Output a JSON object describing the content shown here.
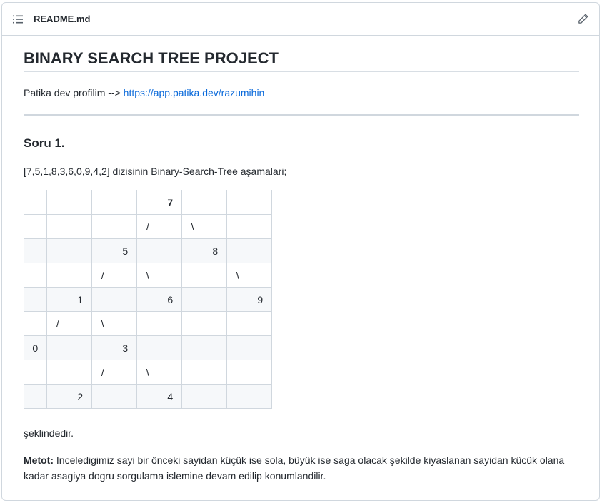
{
  "file": {
    "name": "README.md",
    "list_icon": "list-unordered-icon",
    "edit_icon": "pencil-icon"
  },
  "readme": {
    "title": "BINARY SEARCH TREE PROJECT",
    "profile_prefix": "Patika dev profilim -->",
    "profile_link": "https://app.patika.dev/razumihin",
    "question_heading": "Soru 1.",
    "intro": "[7,5,1,8,3,6,0,9,4,2] dizisinin Binary-Search-Tree aşamalari;",
    "tree_grid": [
      [
        "",
        "",
        "",
        "",
        "",
        "",
        "7",
        "",
        "",
        "",
        ""
      ],
      [
        "",
        "",
        "",
        "",
        "",
        "/",
        "",
        "\\",
        "",
        "",
        ""
      ],
      [
        "",
        "",
        "",
        "",
        "5",
        "",
        "",
        "",
        "8",
        "",
        ""
      ],
      [
        "",
        "",
        "",
        "/",
        "",
        "\\",
        "",
        "",
        "",
        "\\",
        ""
      ],
      [
        "",
        "",
        "1",
        "",
        "",
        "",
        "6",
        "",
        "",
        "",
        "9"
      ],
      [
        "",
        "/",
        "",
        "\\",
        "",
        "",
        "",
        "",
        "",
        "",
        ""
      ],
      [
        "0",
        "",
        "",
        "",
        "3",
        "",
        "",
        "",
        "",
        "",
        ""
      ],
      [
        "",
        "",
        "",
        "/",
        "",
        "\\",
        "",
        "",
        "",
        "",
        ""
      ],
      [
        "",
        "",
        "2",
        "",
        "",
        "",
        "4",
        "",
        "",
        "",
        ""
      ]
    ],
    "after_tree": "şeklindedir.",
    "method_label": "Metot:",
    "method_text": " Inceledigimiz sayi bir önceki sayidan küçük ise sola, büyük ise saga olacak şekilde kiyaslanan sayidan kücük olana kadar asagiya dogru sorgulama islemine devam edilip konumlandilir."
  }
}
